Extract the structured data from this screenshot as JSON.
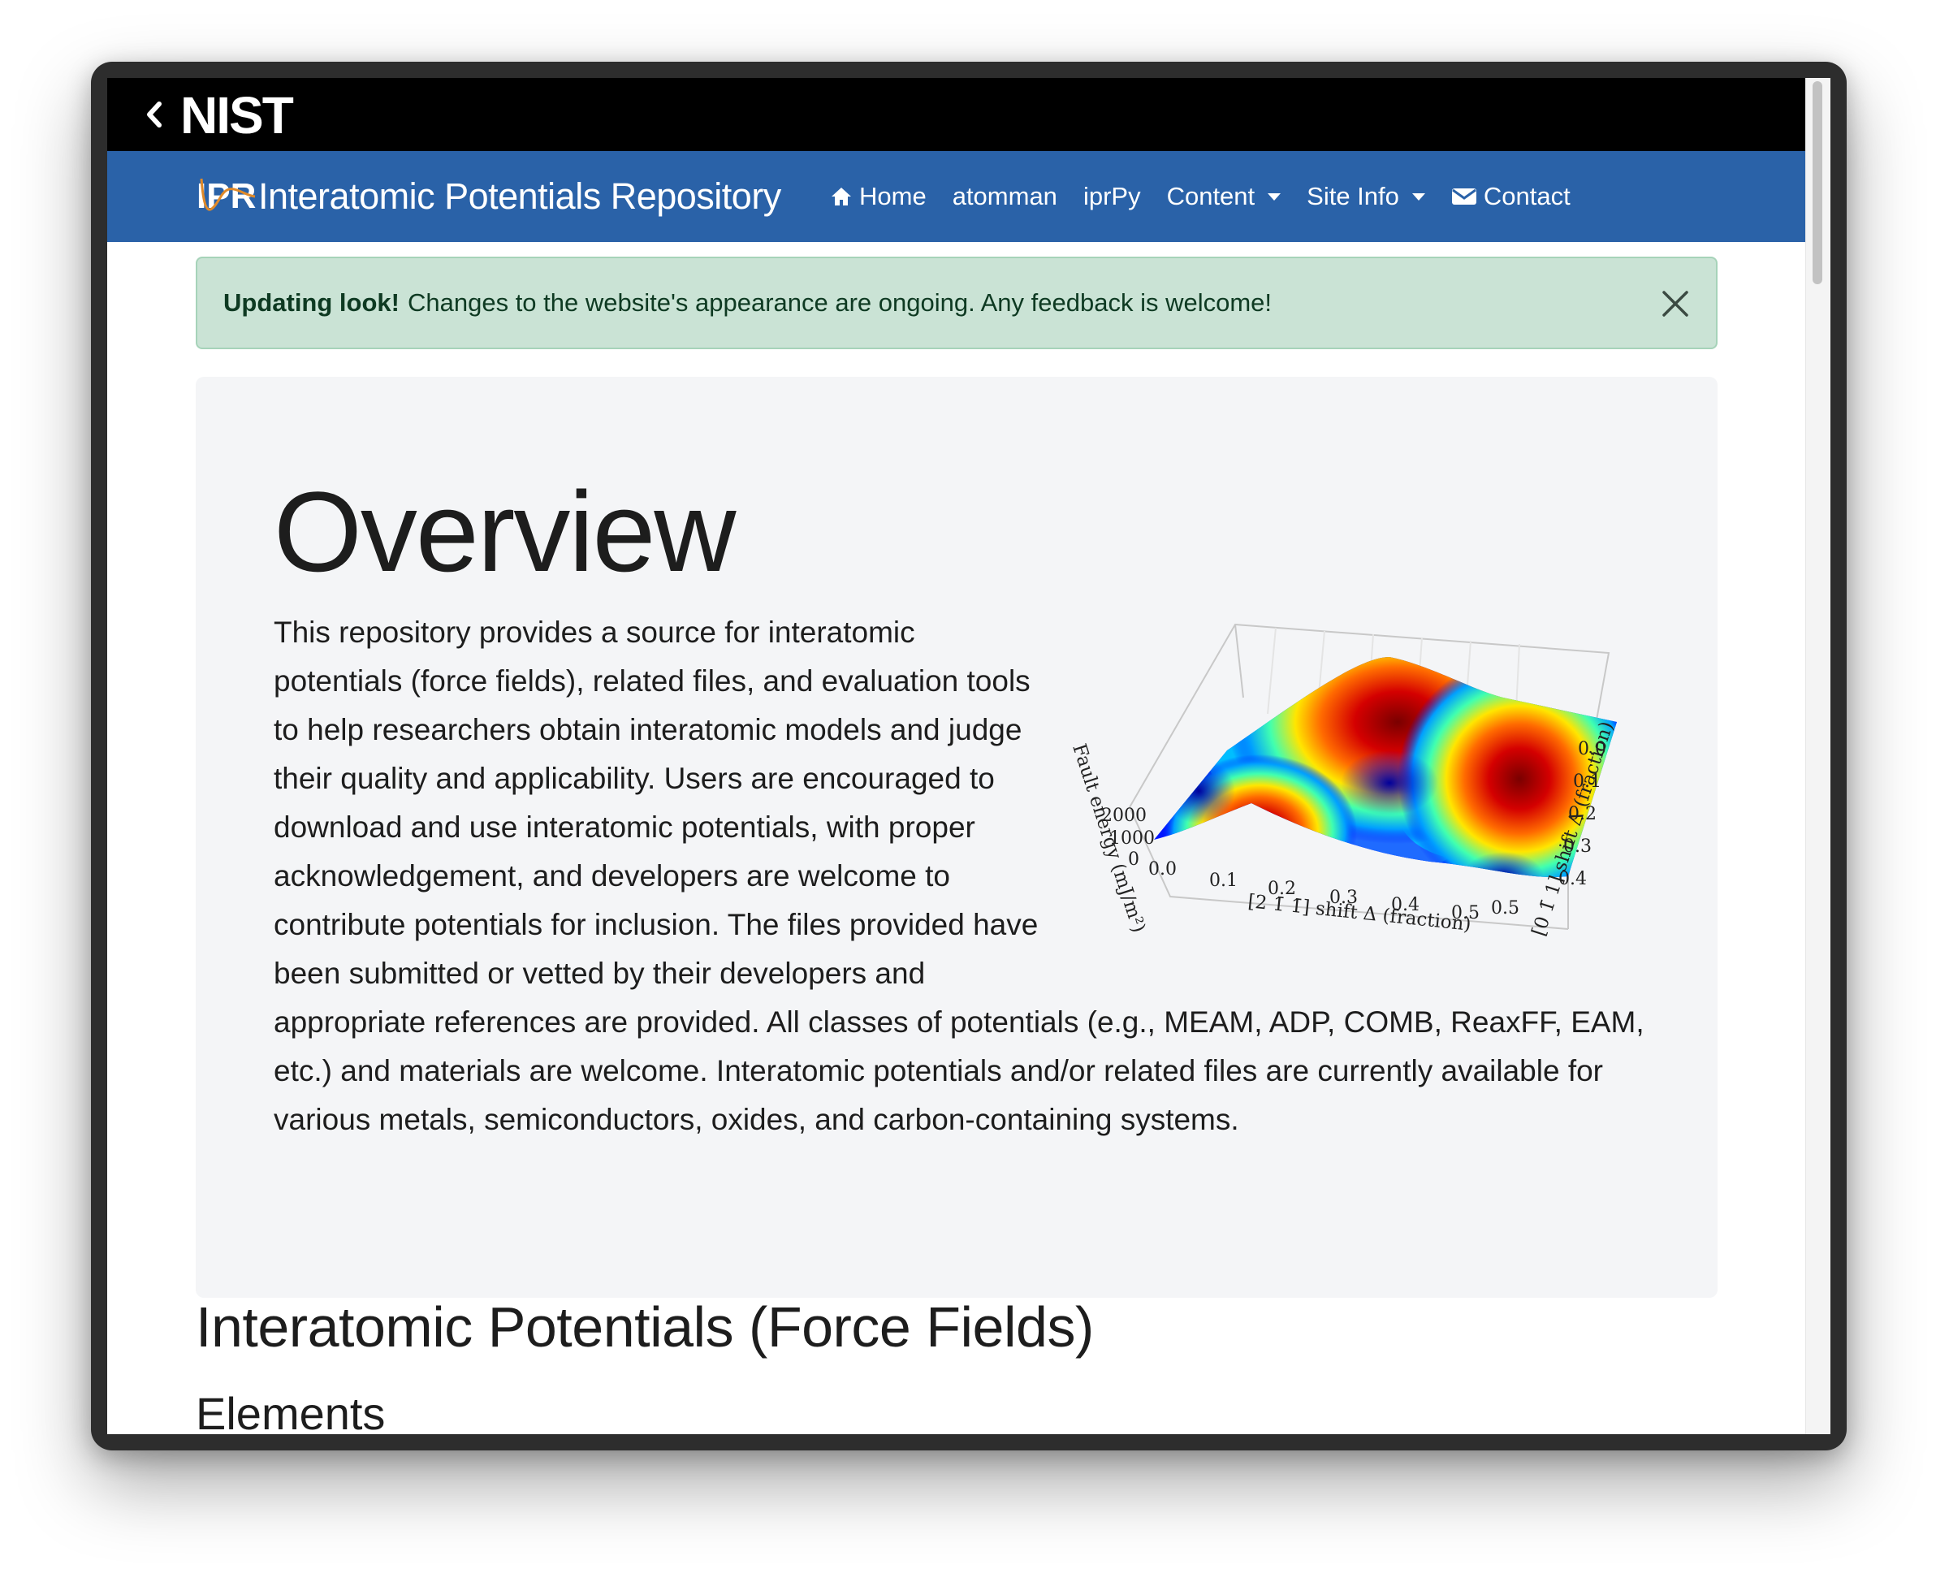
{
  "nist": {
    "logo_text": "NIST"
  },
  "brand": {
    "logo_text": "IPR",
    "title": "Interatomic Potentials Repository"
  },
  "nav": {
    "home": "Home",
    "atomman": "atomman",
    "iprpy": "iprPy",
    "content": "Content",
    "site_info": "Site Info",
    "contact": "Contact"
  },
  "alert": {
    "title": "Updating look!",
    "message": "Changes to the website's appearance are ongoing. Any feedback is welcome!"
  },
  "overview": {
    "title": "Overview",
    "body": "This repository provides a source for interatomic potentials (force fields), related files, and evaluation tools to help researchers obtain interatomic models and judge their quality and applicability. Users are encouraged to download and use interatomic potentials, with proper acknowledgement, and developers are welcome to contribute potentials for inclusion. The files provided have been submitted or vetted by their developers and appropriate references are provided. All classes of potentials (e.g., MEAM, ADP, COMB, ReaxFF, EAM, etc.) and materials are welcome. Interatomic potentials and/or related files are currently available for various metals, semiconductors, oxides, and carbon-containing systems."
  },
  "figure": {
    "z_label": "Fault energy (mJ/m²)",
    "z_ticks": [
      "2000",
      "1000",
      "0"
    ],
    "x_label": "[2 1̄ 1̄] shift Δ (fraction)",
    "x_ticks": [
      "0.0",
      "0.1",
      "0.2",
      "0.3",
      "0.4",
      "0.5"
    ],
    "y_label": "[0 1̄ 1] shift Δ (fraction)",
    "y_ticks": [
      "0.0",
      "0.1",
      "0.2",
      "0.3",
      "0.4",
      "0.5"
    ]
  },
  "sections": {
    "potentials_heading": "Interatomic Potentials (Force Fields)",
    "elements_heading": "Elements"
  }
}
